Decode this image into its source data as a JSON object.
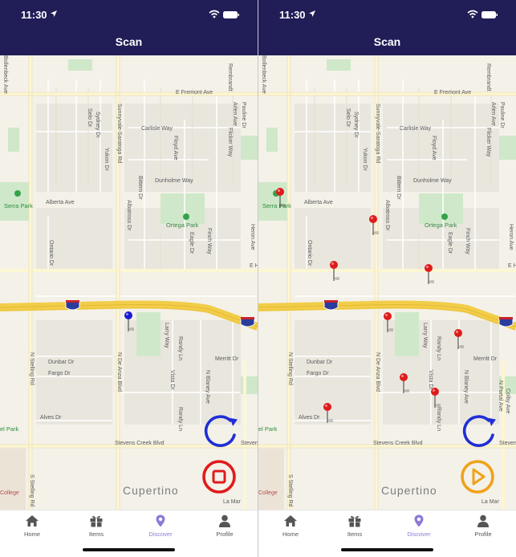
{
  "status": {
    "time": "11:30"
  },
  "header": {
    "title": "Scan"
  },
  "map": {
    "streets": {
      "fremont": "E Fremont Ave",
      "alberta": "Alberta Ave",
      "carlisle": "Carlisle Way",
      "dunholme": "Dunholme Way",
      "sunnyvale": "Sunnyvale-Saratoga Rd",
      "de_anza": "N De Anza Blvd",
      "stelling_n": "N Stelling Rd",
      "stelling_s": "S Stelling Rd",
      "stevens": "Stevens Creek Blvd",
      "blaney": "N Blaney Ave",
      "dunbar": "Dunbar Dr",
      "fargo": "Fargo Dr",
      "alves": "Alves Dr",
      "merritt": "Merritt Dr",
      "larry": "Larry Way",
      "randy": "Randy Ln",
      "vista": "Vista Dr",
      "finch": "Finch Way",
      "floyd": "Floyd Ave",
      "eagle": "Eagle Dr",
      "albatross": "Albatross Dr",
      "bittern": "Bittern Dr",
      "ontario": "Ontario Dr",
      "yukon": "Yukon Dr",
      "selo": "Selo Dr",
      "sydney": "Sydney Dr",
      "arlen": "Arlen Ave",
      "pauline": "Pauline Dr",
      "flicker": "Flicker Way",
      "heron": "Heron Ave",
      "portal": "N Portal Ave",
      "colby": "Colby Ave",
      "rembrandt": "Rembrandt",
      "lamar": "La Mar",
      "bollenbeck": "Bollenbeck Ave",
      "e_h": "E H"
    },
    "parks": {
      "serra": "Serra Park",
      "ortega": "Ortega Park",
      "el_park": "el Park"
    },
    "city": "Cupertino",
    "college": "College",
    "highway": "280"
  },
  "left": {
    "scan_state": "scanning",
    "pins": 1
  },
  "right": {
    "scan_state": "paused",
    "pins": 10
  },
  "colors": {
    "header_bg": "#211d57",
    "refresh": "#1f2fd6",
    "stop": "#e01b1b",
    "play": "#f0a21a",
    "pin_blue": "#1b1bd6",
    "pin_red": "#e01b1b",
    "tab_active": "#8e7ad6"
  },
  "tabs": [
    {
      "label": "Home",
      "icon": "home-icon"
    },
    {
      "label": "Items",
      "icon": "gift-icon"
    },
    {
      "label": "Discover",
      "icon": "location-pin-icon"
    },
    {
      "label": "Profile",
      "icon": "person-icon"
    }
  ]
}
